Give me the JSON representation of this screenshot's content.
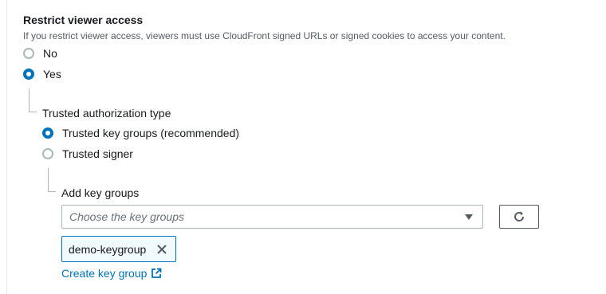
{
  "restrict_viewer_access": {
    "label": "Restrict viewer access",
    "description": "If you restrict viewer access, viewers must use CloudFront signed URLs or signed cookies to access your content.",
    "options": [
      {
        "label": "No",
        "checked": false
      },
      {
        "label": "Yes",
        "checked": true
      }
    ]
  },
  "trusted_authorization_type": {
    "label": "Trusted authorization type",
    "options": [
      {
        "label": "Trusted key groups (recommended)",
        "checked": true
      },
      {
        "label": "Trusted signer",
        "checked": false
      }
    ]
  },
  "add_key_groups": {
    "label": "Add key groups",
    "select_placeholder": "Choose the key groups",
    "refresh_icon": "refresh-icon",
    "selected_tokens": [
      {
        "label": "demo-keygroup",
        "remove_icon": "close-icon"
      }
    ],
    "create_link": "Create key group",
    "create_link_icon": "external-link-icon"
  },
  "colors": {
    "accent": "#0073bb",
    "text": "#16191f",
    "muted": "#545b64",
    "border": "#aab7b8",
    "token_bg": "#f1faff"
  }
}
